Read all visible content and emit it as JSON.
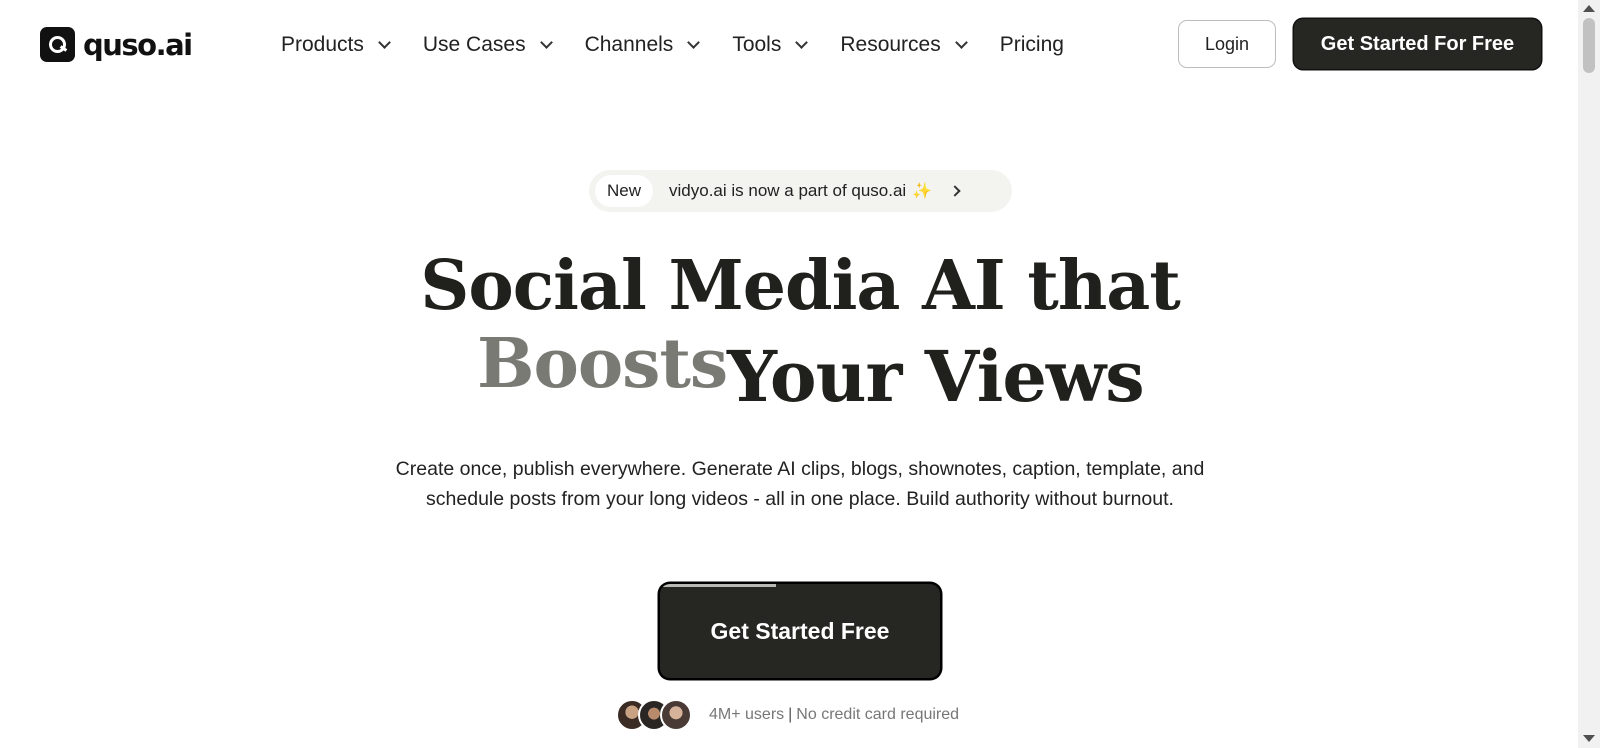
{
  "brand": {
    "name": "quso.ai"
  },
  "nav": {
    "items": [
      {
        "label": "Products",
        "has_dropdown": true
      },
      {
        "label": "Use Cases",
        "has_dropdown": true
      },
      {
        "label": "Channels",
        "has_dropdown": true
      },
      {
        "label": "Tools",
        "has_dropdown": true
      },
      {
        "label": "Resources",
        "has_dropdown": true
      },
      {
        "label": "Pricing",
        "has_dropdown": false
      }
    ]
  },
  "header": {
    "login_label": "Login",
    "cta_label": "Get Started For Free"
  },
  "announcement": {
    "badge": "New",
    "text": "vidyo.ai is now a part of quso.ai",
    "emoji": "✨"
  },
  "hero": {
    "line1": "Social Media AI that",
    "line2_highlight": "Boosts",
    "line2_rest": "Your Views",
    "subtitle": "Create once, publish everywhere. Generate AI clips, blogs, shownotes, caption, template, and schedule posts from your long videos - all in one place. Build authority without burnout.",
    "cta_label": "Get Started Free",
    "users_text": "4M+ users",
    "separator": "|",
    "no_card_text": "No credit card required"
  },
  "colors": {
    "dark": "#262623",
    "text": "#20201c",
    "muted_headline": "#7a7a75",
    "pill_bg": "#f3f3ef"
  }
}
